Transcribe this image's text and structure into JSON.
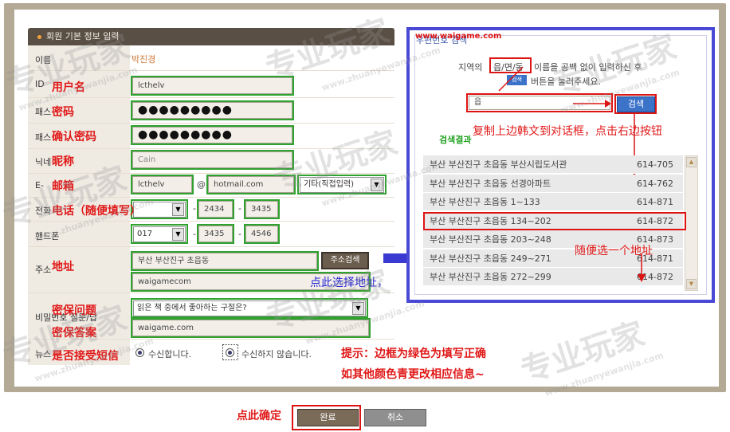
{
  "form": {
    "header": "회원 기본 정보 입력",
    "name_label": "이름",
    "name_value": "박진경",
    "id_label": "ID",
    "id_value": "lcthelv",
    "pw_label": "패스",
    "pw_value": "●●●●●●●●●",
    "pw2_label": "패스",
    "pw2_value": "●●●●●●●●●",
    "nick_label": "닉네",
    "nick_value": "Cain",
    "email_label": "E-",
    "email_user": "lcthelv",
    "email_at": "@",
    "email_domain": "hotmail.com",
    "email_select": "기타(직접입력)",
    "phone_label": "전화",
    "phone_mid": "2434",
    "phone_last": "3435",
    "mobile_label": "핸드폰",
    "mobile_prefix": "017",
    "mobile_mid": "3435",
    "mobile_last": "4546",
    "address_label": "주소",
    "address_value": "부산 부산진구 초읍동",
    "address_detail": "waigamecom",
    "address_button": "주소검색",
    "question_label": "비밀번호 질문/답",
    "question_select": "읽은 책 중에서 좋아하는 구절은?",
    "answer_value": "waigame.com",
    "news_label": "뉴스",
    "radio_yes": "수신합니다.",
    "radio_no": "수신하지 않습니다.",
    "dash": "-"
  },
  "annotations": {
    "username": "用户名",
    "password": "密码",
    "confirm_password": "确认密码",
    "nickname": "昵称",
    "email": "邮箱",
    "phone": "电话（随便填写）",
    "address": "地址",
    "security_question": "密保问题",
    "security_answer": "密保答案",
    "sms": "是否接受短信",
    "click_address": "点此选择地址，",
    "copy_hint": "复制上边韩文到对话框，点击右边按钮",
    "pick_any": "随便选一个地址",
    "tip_line1": "提示：边框为绿色为填写正确",
    "tip_line2": "如其他颜色青更改相应信息~",
    "click_confirm": "点此确定",
    "watermark_url": "www.waigame.com"
  },
  "popup": {
    "title": "우편번호 검색",
    "instruction_pre": "지역의",
    "instruction_highlight": "읍/면/동",
    "instruction_post": "이름을 공백 없이 입력하신 후",
    "mini_button": "검색",
    "instruction_line2": "버튼을 눌러주세요.",
    "search_value": "읍",
    "search_button": "검색",
    "results_label": "검색결과",
    "results": [
      {
        "address": "부산 부산진구 초읍동 부산시립도서관",
        "code": "614-705"
      },
      {
        "address": "부산 부산진구 초읍동 선경아파트",
        "code": "614-762"
      },
      {
        "address": "부산 부산진구 초읍동 1~133",
        "code": "614-871"
      },
      {
        "address": "부산 부산진구 초읍동 134~202",
        "code": "614-872"
      },
      {
        "address": "부산 부산진구 초읍동 203~248",
        "code": "614-873"
      },
      {
        "address": "부산 부산진구 초읍동 249~271",
        "code": "614-871"
      },
      {
        "address": "부산 부산진구 초읍동 272~299",
        "code": "614-872"
      }
    ]
  },
  "buttons": {
    "confirm": "완료",
    "cancel": "취소"
  },
  "watermark": {
    "cn": "专业玩家",
    "url": "www.zhuanyewanjia.com"
  },
  "colors": {
    "valid_border": "#2fa22f",
    "highlight_border": "#dd1414",
    "annotation_red": "#e01818",
    "annotation_blue": "#2323d4",
    "popup_border": "#4a49d6"
  }
}
